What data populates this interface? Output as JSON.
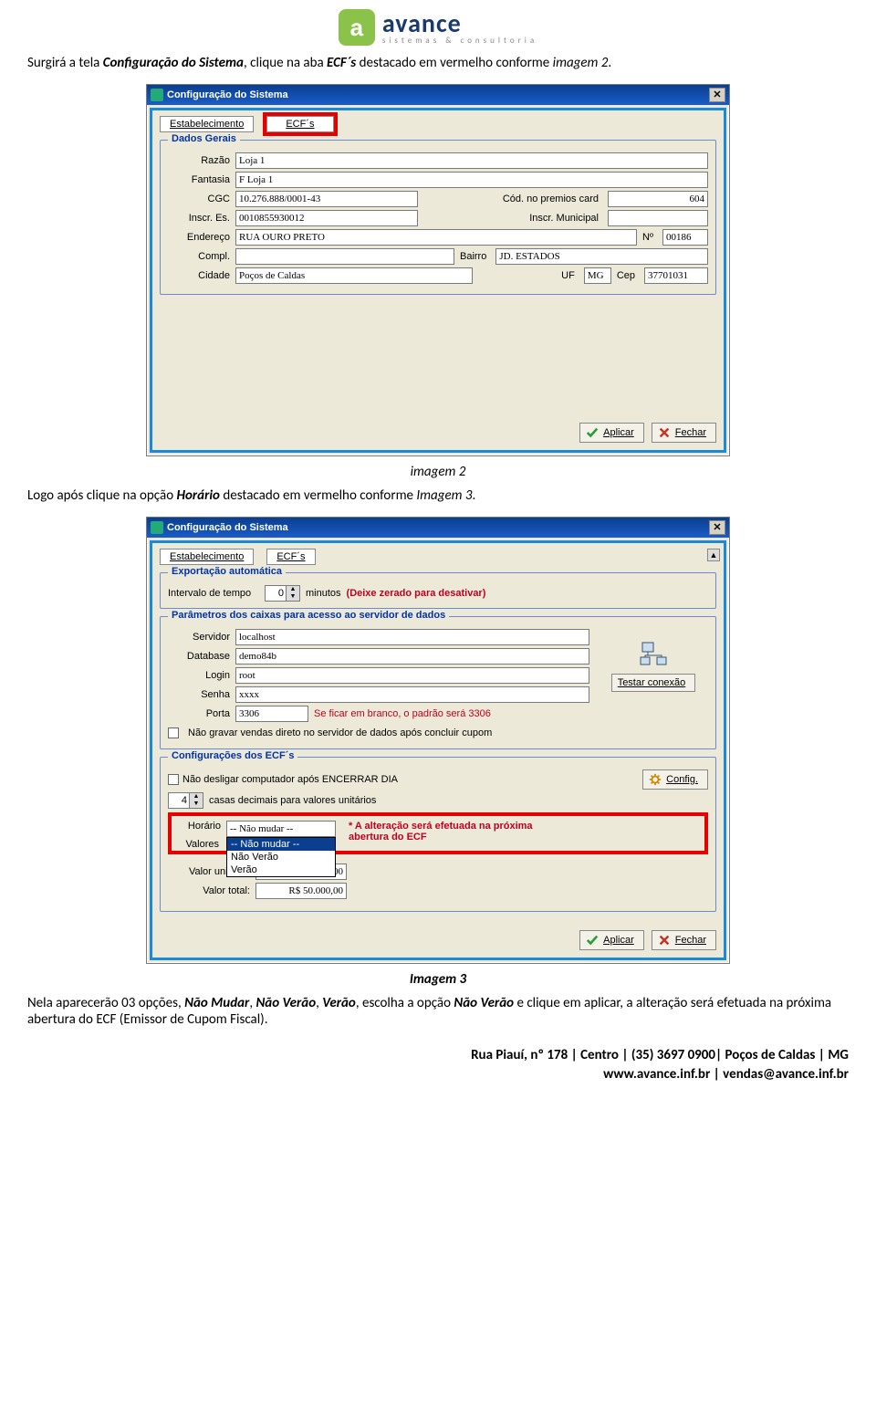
{
  "logo": {
    "brand": "avance",
    "tagline": "sistemas & consultoria",
    "mark": "a"
  },
  "intro1": {
    "prefix": "Surgirá a tela ",
    "bold1": "Configuração do Sistema",
    "mid": ", clique na aba ",
    "bold2": "ECF´s",
    "mid2": " destacado em vermelho conforme ",
    "ital": "imagem 2",
    "end": "."
  },
  "dialog1": {
    "title": "Configuração do Sistema",
    "tabs": {
      "estab": "Estabelecimento",
      "ecfs": "ECF´s"
    },
    "group": "Dados Gerais",
    "labels": {
      "razao": "Razão",
      "fantasia": "Fantasia",
      "cgc": "CGC",
      "codcard": "Cód. no premios card",
      "inscres": "Inscr. Es.",
      "inscrmun": "Inscr. Municipal",
      "endereco": "Endereço",
      "num": "Nº",
      "compl": "Compl.",
      "bairro": "Bairro",
      "cidade": "Cidade",
      "uf": "UF",
      "cep": "Cep"
    },
    "values": {
      "razao": "Loja 1",
      "fantasia": "F Loja 1",
      "cgc": "10.276.888/0001-43",
      "codcard": "604",
      "inscres": "0010855930012",
      "inscrmun": "",
      "endereco": "RUA OURO PRETO",
      "num": "00186",
      "compl": "",
      "bairro": "JD. ESTADOS",
      "cidade": "Poços de Caldas",
      "uf": "MG",
      "cep": "37701031"
    },
    "btns": {
      "aplicar": "Aplicar",
      "fechar": "Fechar"
    }
  },
  "caption2": "imagem 2",
  "intro2": {
    "prefix": "Logo após clique na opção ",
    "bold": "Horário",
    "mid": " destacado em vermelho conforme ",
    "ital": "Imagem 3",
    "end": "."
  },
  "dialog2": {
    "title": "Configuração do Sistema",
    "tabs": {
      "estab": "Estabelecimento",
      "ecfs": "ECF´s"
    },
    "exp": {
      "title": "Exportação automática",
      "intervalo_lbl": "Intervalo de tempo",
      "intervalo_val": "0",
      "minutos": "minutos",
      "deixe": "(Deixe zerado para desativar)"
    },
    "params": {
      "title": "Parâmetros dos caixas para acesso ao servidor de dados",
      "servidor_lbl": "Servidor",
      "servidor": "localhost",
      "database_lbl": "Database",
      "database": "demo84b",
      "login_lbl": "Login",
      "login": "root",
      "senha_lbl": "Senha",
      "senha": "xxxx",
      "porta_lbl": "Porta",
      "porta": "3306",
      "testar": "Testar conexão",
      "note": "Se ficar em branco, o padrão será 3306",
      "chk": "Não gravar vendas direto no servidor de dados após concluir cupom"
    },
    "cfgecf": {
      "title": "Configurações dos ECF´s",
      "chk": "Não desligar computador após ENCERRAR DIA",
      "config": "Config.",
      "casas_val": "4",
      "casas": "casas decimais para valores unitários",
      "horario_lbl": "Horário",
      "horario_sel": "-- Não mudar --",
      "opt1": "-- Não mudar --",
      "opt2": "Não Verão",
      "opt3": "Verão",
      "hor_note": "* A alteração será efetuada na próxima abertura do ECF",
      "valores_lbl": "Valores",
      "vu_lbl": "Valor unitário:",
      "vu": "R$ 5.000,00",
      "vt_lbl": "Valor total:",
      "vt": "R$ 50.000,00"
    },
    "btns": {
      "aplicar": "Aplicar",
      "fechar": "Fechar"
    }
  },
  "caption3": "Imagem 3",
  "intro3": {
    "prefix": "Nela aparecerão 03 opções, ",
    "b1": "Não Mudar",
    "c1": ", ",
    "b2": "Não Verão",
    "c2": ", ",
    "b3": "Verão",
    "mid": ", escolha a opção ",
    "b4": "Não Verão",
    "rest": " e clique em aplicar, a alteração será efetuada na próxima abertura do ECF (Emissor de Cupom Fiscal)."
  },
  "footer": {
    "l1": "Rua Piauí, nº 178 | Centro | (35) 3697 0900| Poços de Caldas | MG",
    "l2": "www.avance.inf.br | vendas@avance.inf.br"
  }
}
